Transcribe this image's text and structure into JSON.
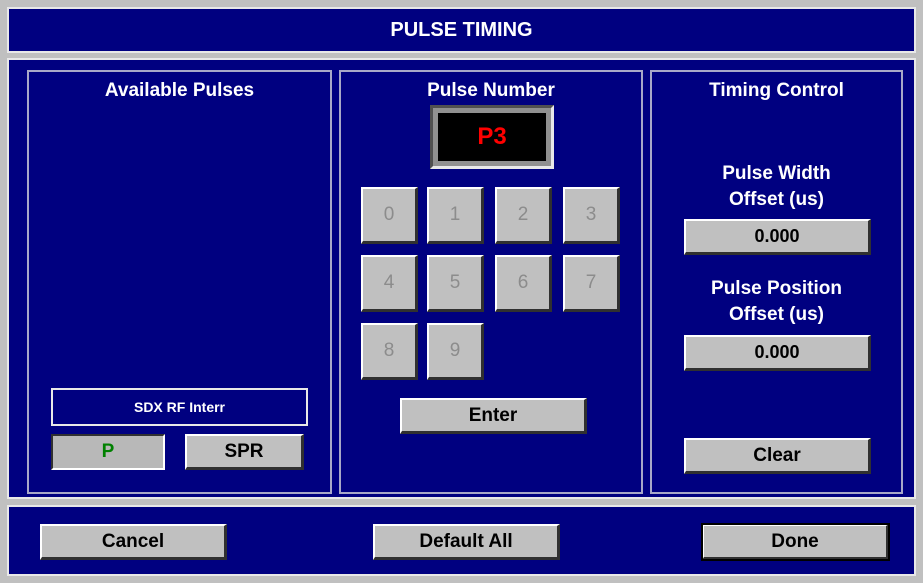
{
  "title": "PULSE TIMING",
  "available": {
    "title": "Available Pulses",
    "pulse_name": "SDX RF Interr",
    "buttons": [
      "P",
      "SPR"
    ]
  },
  "pulse_number": {
    "title": "Pulse Number",
    "display": "P3",
    "keys": [
      "0",
      "1",
      "2",
      "3",
      "4",
      "5",
      "6",
      "7",
      "8",
      "9"
    ],
    "enter_label": "Enter"
  },
  "timing": {
    "title": "Timing Control",
    "width_label_1": "Pulse Width",
    "width_label_2": "Offset (us)",
    "width_value": "0.000",
    "position_label_1": "Pulse Position",
    "position_label_2": "Offset (us)",
    "position_value": "0.000",
    "clear_label": "Clear"
  },
  "footer": {
    "cancel_label": "Cancel",
    "default_all_label": "Default All",
    "done_label": "Done"
  },
  "colors": {
    "panel_bg": "#000080",
    "display_bg": "#000000",
    "display_text": "#ff0000",
    "selected_pulse_text": "#008000"
  }
}
